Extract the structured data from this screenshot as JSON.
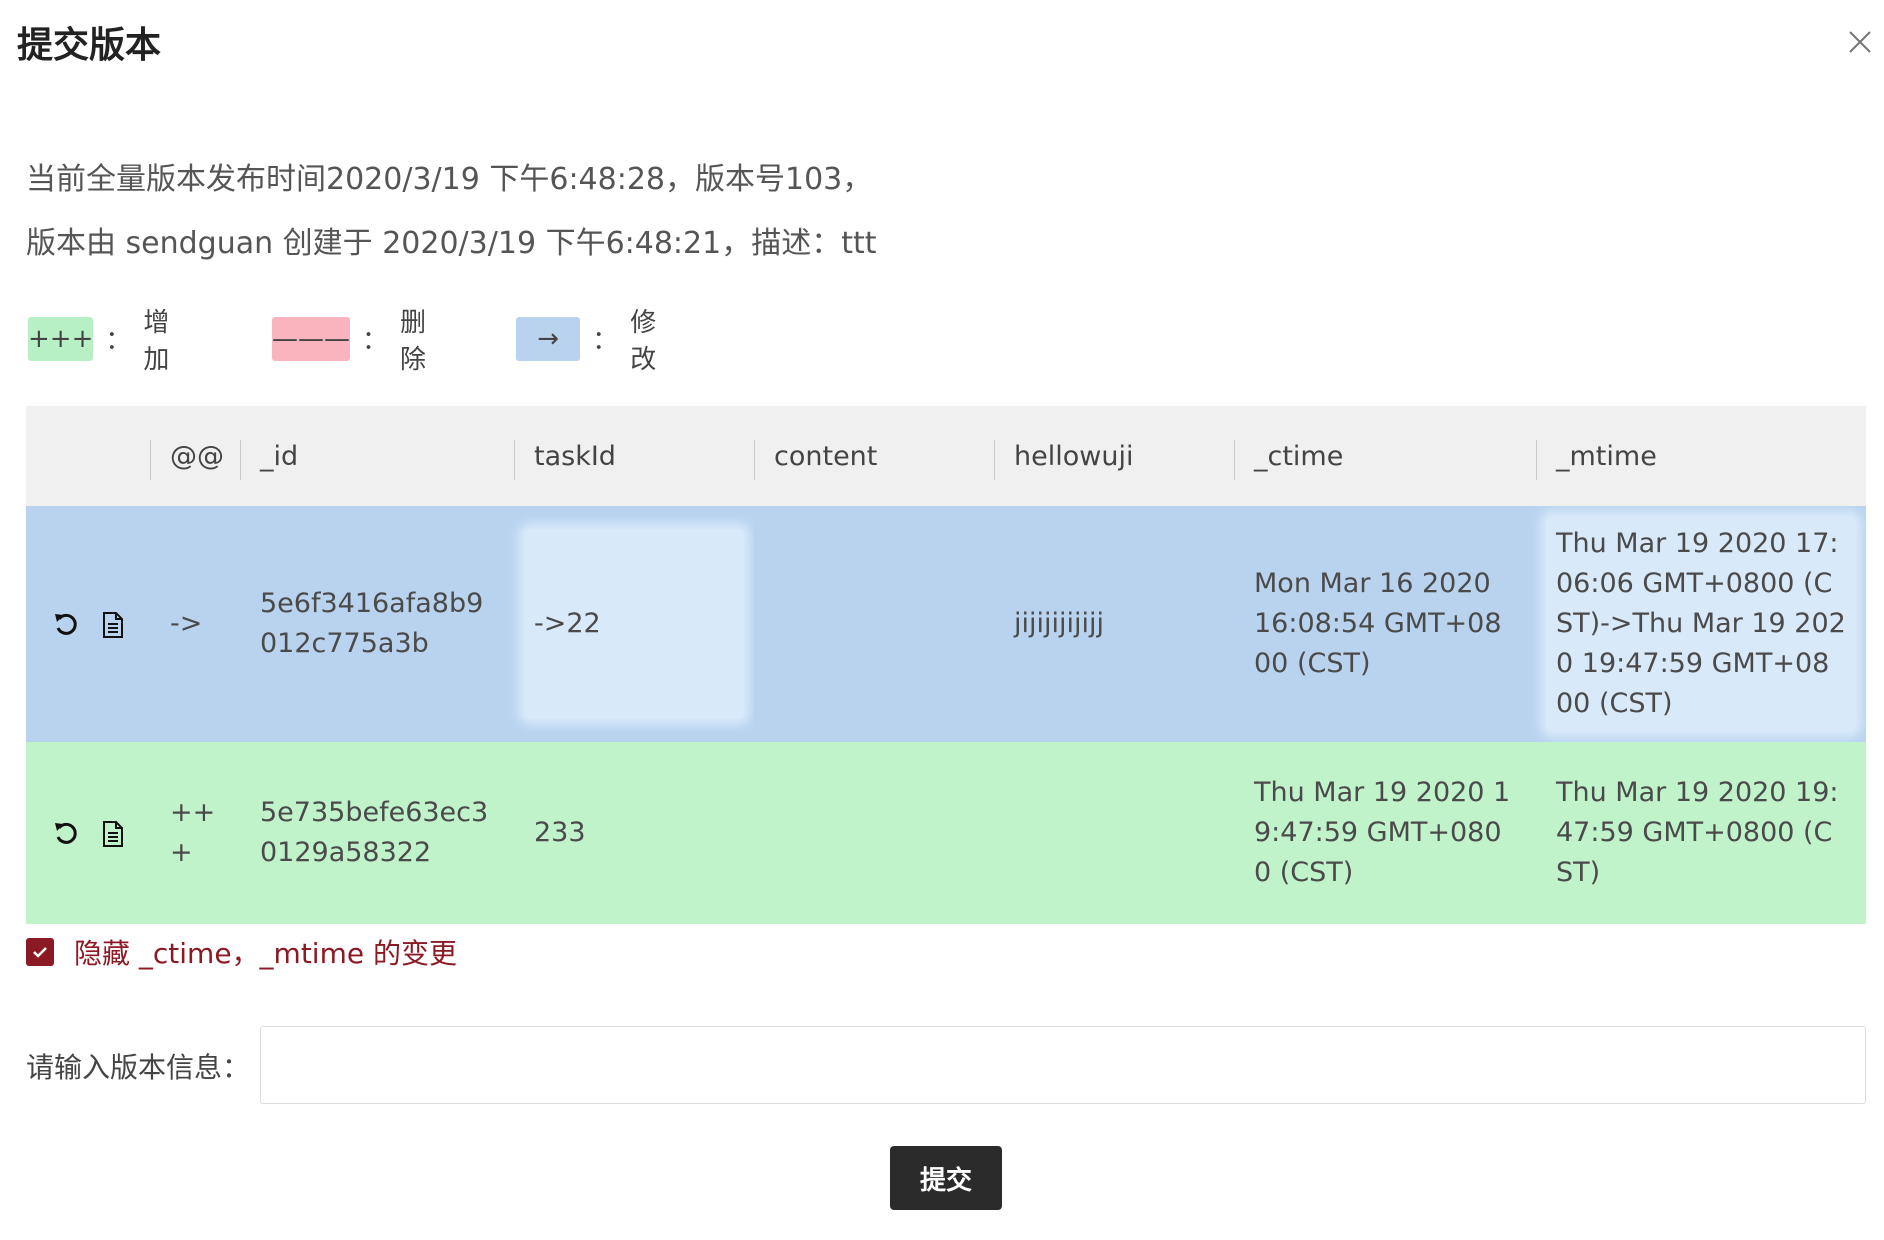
{
  "dialog": {
    "title": "提交版本",
    "close_icon": "close-icon"
  },
  "info": {
    "line1": "当前全量版本发布时间2020/3/19 下午6:48:28，版本号103，",
    "line2": "版本由 sendguan 创建于 2020/3/19 下午6:48:21，描述：ttt"
  },
  "legend": {
    "colon": "：",
    "items": [
      {
        "symbol": "+++",
        "label": "增加",
        "color": "#b8f0c6"
      },
      {
        "symbol": "———",
        "label": "删除",
        "color": "#f9b4be"
      },
      {
        "symbol": "→",
        "label": "修改",
        "color": "#b9d3ef"
      }
    ]
  },
  "table": {
    "columns": [
      "",
      "@@",
      "_id",
      "taskId",
      "content",
      "hellowuji",
      "_ctime",
      "_mtime"
    ],
    "rows": [
      {
        "type": "modify",
        "color": "#b9d3ef",
        "op": "->",
        "_id": "5e6f3416afa8b9012c775a3b",
        "taskId": "->22",
        "content": "",
        "hellowuji": "jijijijijijj",
        "_ctime": "Mon Mar 16 2020 16:08:54 GMT+0800 (CST)",
        "_mtime": "Thu Mar 19 2020 17:06:06 GMT+0800 (CST)->Thu Mar 19 2020 19:47:59 GMT+0800 (CST)"
      },
      {
        "type": "add",
        "color": "#c1f3cb",
        "op": "+++",
        "_id": "5e735befe63ec30129a58322",
        "taskId": "233",
        "content": "",
        "hellowuji": "",
        "_ctime": "Thu Mar 19 2020 19:47:59 GMT+0800 (CST)",
        "_mtime": "Thu Mar 19 2020 19:47:59 GMT+0800 (CST)"
      }
    ]
  },
  "options": {
    "hide_time_changes": {
      "label": "隐藏 _ctime，_mtime 的变更",
      "checked": true
    }
  },
  "version": {
    "label": "请输入版本信息：",
    "value": "",
    "placeholder": ""
  },
  "submit": {
    "label": "提交"
  },
  "icons": {
    "revert": "undo-icon",
    "detail": "document-icon",
    "check": "check-icon"
  },
  "colors": {
    "accent": "#8c1a24",
    "button": "#2b2b2b",
    "header_bg": "#f0f0f0"
  }
}
